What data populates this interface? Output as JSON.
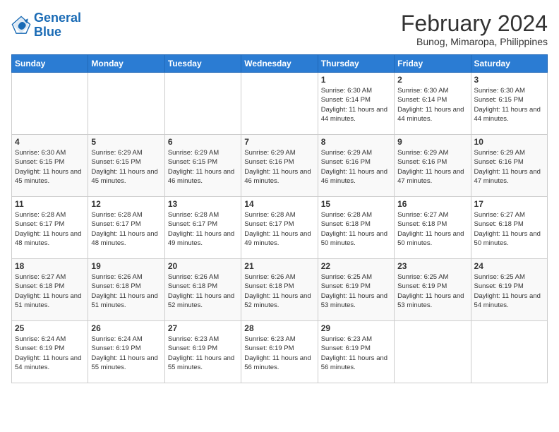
{
  "header": {
    "logo_line1": "General",
    "logo_line2": "Blue",
    "title": "February 2024",
    "subtitle": "Bunog, Mimaropa, Philippines"
  },
  "days_of_week": [
    "Sunday",
    "Monday",
    "Tuesday",
    "Wednesday",
    "Thursday",
    "Friday",
    "Saturday"
  ],
  "weeks": [
    [
      {
        "day": "",
        "info": ""
      },
      {
        "day": "",
        "info": ""
      },
      {
        "day": "",
        "info": ""
      },
      {
        "day": "",
        "info": ""
      },
      {
        "day": "1",
        "info": "Sunrise: 6:30 AM\nSunset: 6:14 PM\nDaylight: 11 hours and 44 minutes."
      },
      {
        "day": "2",
        "info": "Sunrise: 6:30 AM\nSunset: 6:14 PM\nDaylight: 11 hours and 44 minutes."
      },
      {
        "day": "3",
        "info": "Sunrise: 6:30 AM\nSunset: 6:15 PM\nDaylight: 11 hours and 44 minutes."
      }
    ],
    [
      {
        "day": "4",
        "info": "Sunrise: 6:30 AM\nSunset: 6:15 PM\nDaylight: 11 hours and 45 minutes."
      },
      {
        "day": "5",
        "info": "Sunrise: 6:29 AM\nSunset: 6:15 PM\nDaylight: 11 hours and 45 minutes."
      },
      {
        "day": "6",
        "info": "Sunrise: 6:29 AM\nSunset: 6:15 PM\nDaylight: 11 hours and 46 minutes."
      },
      {
        "day": "7",
        "info": "Sunrise: 6:29 AM\nSunset: 6:16 PM\nDaylight: 11 hours and 46 minutes."
      },
      {
        "day": "8",
        "info": "Sunrise: 6:29 AM\nSunset: 6:16 PM\nDaylight: 11 hours and 46 minutes."
      },
      {
        "day": "9",
        "info": "Sunrise: 6:29 AM\nSunset: 6:16 PM\nDaylight: 11 hours and 47 minutes."
      },
      {
        "day": "10",
        "info": "Sunrise: 6:29 AM\nSunset: 6:16 PM\nDaylight: 11 hours and 47 minutes."
      }
    ],
    [
      {
        "day": "11",
        "info": "Sunrise: 6:28 AM\nSunset: 6:17 PM\nDaylight: 11 hours and 48 minutes."
      },
      {
        "day": "12",
        "info": "Sunrise: 6:28 AM\nSunset: 6:17 PM\nDaylight: 11 hours and 48 minutes."
      },
      {
        "day": "13",
        "info": "Sunrise: 6:28 AM\nSunset: 6:17 PM\nDaylight: 11 hours and 49 minutes."
      },
      {
        "day": "14",
        "info": "Sunrise: 6:28 AM\nSunset: 6:17 PM\nDaylight: 11 hours and 49 minutes."
      },
      {
        "day": "15",
        "info": "Sunrise: 6:28 AM\nSunset: 6:18 PM\nDaylight: 11 hours and 50 minutes."
      },
      {
        "day": "16",
        "info": "Sunrise: 6:27 AM\nSunset: 6:18 PM\nDaylight: 11 hours and 50 minutes."
      },
      {
        "day": "17",
        "info": "Sunrise: 6:27 AM\nSunset: 6:18 PM\nDaylight: 11 hours and 50 minutes."
      }
    ],
    [
      {
        "day": "18",
        "info": "Sunrise: 6:27 AM\nSunset: 6:18 PM\nDaylight: 11 hours and 51 minutes."
      },
      {
        "day": "19",
        "info": "Sunrise: 6:26 AM\nSunset: 6:18 PM\nDaylight: 11 hours and 51 minutes."
      },
      {
        "day": "20",
        "info": "Sunrise: 6:26 AM\nSunset: 6:18 PM\nDaylight: 11 hours and 52 minutes."
      },
      {
        "day": "21",
        "info": "Sunrise: 6:26 AM\nSunset: 6:18 PM\nDaylight: 11 hours and 52 minutes."
      },
      {
        "day": "22",
        "info": "Sunrise: 6:25 AM\nSunset: 6:19 PM\nDaylight: 11 hours and 53 minutes."
      },
      {
        "day": "23",
        "info": "Sunrise: 6:25 AM\nSunset: 6:19 PM\nDaylight: 11 hours and 53 minutes."
      },
      {
        "day": "24",
        "info": "Sunrise: 6:25 AM\nSunset: 6:19 PM\nDaylight: 11 hours and 54 minutes."
      }
    ],
    [
      {
        "day": "25",
        "info": "Sunrise: 6:24 AM\nSunset: 6:19 PM\nDaylight: 11 hours and 54 minutes."
      },
      {
        "day": "26",
        "info": "Sunrise: 6:24 AM\nSunset: 6:19 PM\nDaylight: 11 hours and 55 minutes."
      },
      {
        "day": "27",
        "info": "Sunrise: 6:23 AM\nSunset: 6:19 PM\nDaylight: 11 hours and 55 minutes."
      },
      {
        "day": "28",
        "info": "Sunrise: 6:23 AM\nSunset: 6:19 PM\nDaylight: 11 hours and 56 minutes."
      },
      {
        "day": "29",
        "info": "Sunrise: 6:23 AM\nSunset: 6:19 PM\nDaylight: 11 hours and 56 minutes."
      },
      {
        "day": "",
        "info": ""
      },
      {
        "day": "",
        "info": ""
      }
    ]
  ]
}
